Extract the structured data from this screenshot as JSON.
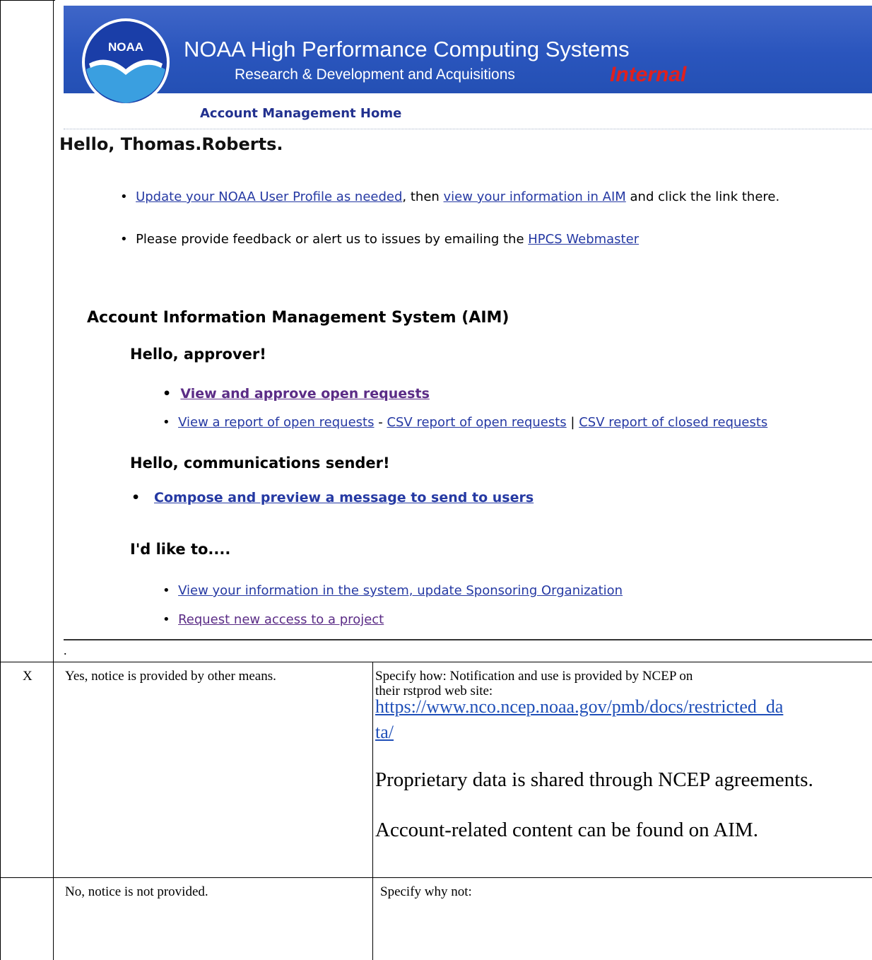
{
  "screenshot": {
    "logo_text": "NOAA",
    "banner_title": "NOAA High Performance Computing Systems",
    "banner_subtitle": "Research & Development and Acquisitions",
    "banner_tag": "Internal",
    "nav_home": "Account Management Home",
    "greeting": "Hello, Thomas.Roberts.",
    "bullet1": {
      "link1": "Update your NOAA User Profile as needed",
      "text1": ", then ",
      "link2": "view your information in AIM",
      "text2": " and click the link there."
    },
    "bullet2": {
      "text": "Please provide feedback or alert us to issues by emailing the ",
      "link": "HPCS Webmaster"
    },
    "aim_heading": "Account Information Management System (AIM)",
    "approver_heading": "Hello, approver!",
    "approver_link1": "View and approve open requests",
    "approver_link2": "View a report of open requests",
    "approver_sep1": " - ",
    "approver_link3": "CSV report of open requests",
    "approver_sep2": " | ",
    "approver_link4": "CSV report of closed requests",
    "comm_heading": "Hello, communications sender!",
    "comm_link": "Compose and preview a message to send to users",
    "like_heading": "I'd like to....",
    "like_link1": "View your information in the system, update Sponsoring Organization",
    "like_link2": "Request new access to a project",
    "bullet_char": "•"
  },
  "table": {
    "dot": ".",
    "row1": {
      "mark": "X",
      "option": "Yes, notice is provided by other means.",
      "specify_line1": "Specify how: Notification and use is provided by NCEP on",
      "specify_line2": "their rstprod web site:",
      "url_line1": "https://www.nco.ncep.noaa.gov/pmb/docs/restricted_da",
      "url_line2": "ta/",
      "para1": "Proprietary data is shared through NCEP agreements.",
      "para2": "Account-related content can be found on AIM."
    },
    "row2": {
      "mark": "",
      "option": "No, notice is not provided.",
      "specify": "Specify why not:"
    }
  },
  "colors": {
    "banner": "#2a55bd",
    "link": "#2539a3",
    "visited_link": "#5b2c86",
    "internal_tag": "#e0201e"
  }
}
